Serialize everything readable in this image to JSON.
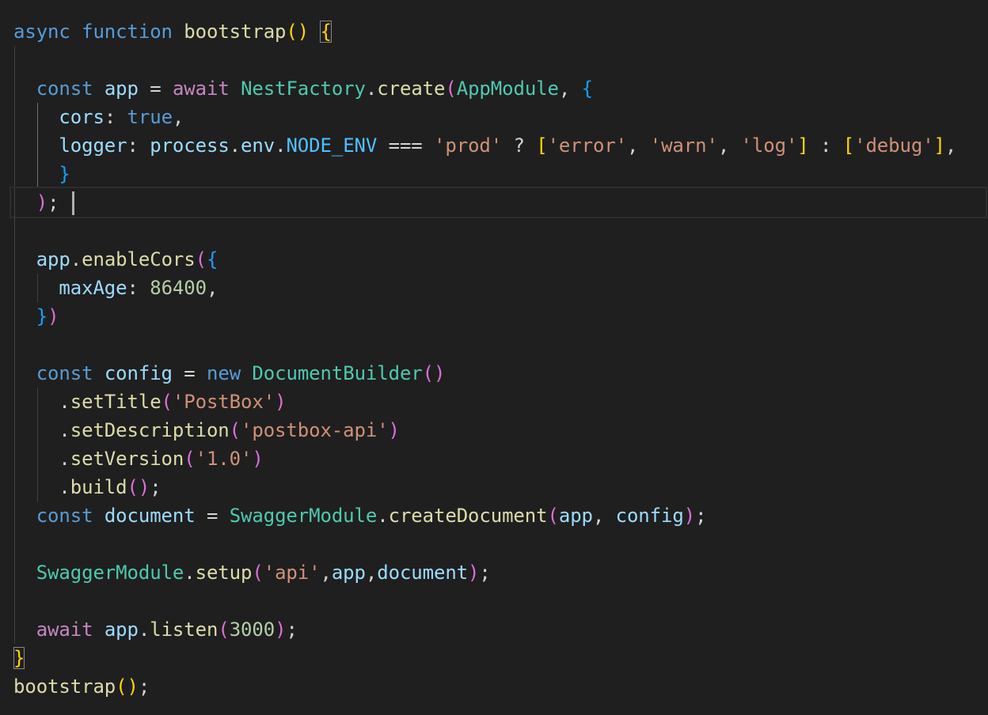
{
  "editor": {
    "language": "typescript",
    "theme_background": "#1f1f1f",
    "cursor_line": 7
  },
  "code": {
    "fn_decl": {
      "async": "async",
      "function": "function",
      "name": "bootstrap",
      "parens": "()",
      "brace": "{"
    },
    "create": {
      "const": "const",
      "app": "app",
      "eq": "=",
      "await": "await",
      "factory": "NestFactory",
      "method": "create",
      "module": "AppModule",
      "cors_key": "cors",
      "cors_val": "true",
      "logger_key": "logger",
      "process": "process",
      "env": "env",
      "node_env": "NODE_ENV",
      "strict_eq": "===",
      "prod": "'prod'",
      "q": "?",
      "err": "'error'",
      "warn": "'warn'",
      "log": "'log'",
      "colon": ":",
      "debug": "'debug'"
    },
    "enable_cors": {
      "app": "app",
      "method": "enableCors",
      "key": "maxAge",
      "value": "86400"
    },
    "config": {
      "const": "const",
      "name": "config",
      "eq": "=",
      "new": "new",
      "builder": "DocumentBuilder",
      "set_title": "setTitle",
      "title": "'PostBox'",
      "set_desc": "setDescription",
      "desc": "'postbox-api'",
      "set_version": "setVersion",
      "version": "'1.0'",
      "build": "build"
    },
    "document": {
      "const": "const",
      "name": "document",
      "eq": "=",
      "module": "SwaggerModule",
      "method": "createDocument",
      "arg1": "app",
      "arg2": "config"
    },
    "setup": {
      "module": "SwaggerModule",
      "method": "setup",
      "path": "'api'",
      "arg1": "app",
      "arg2": "document"
    },
    "listen": {
      "await": "await",
      "app": "app",
      "method": "listen",
      "port": "3000"
    },
    "call": {
      "name": "bootstrap"
    }
  }
}
